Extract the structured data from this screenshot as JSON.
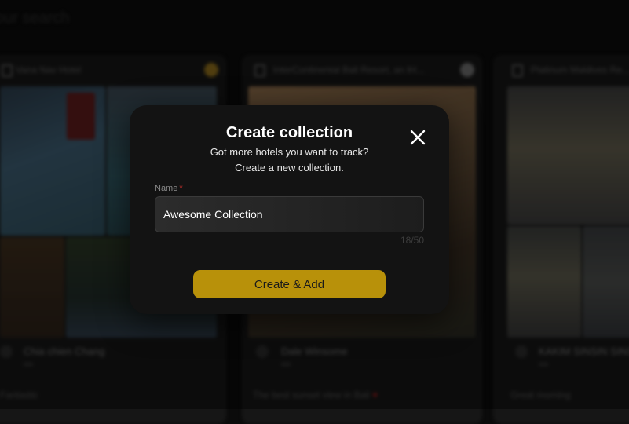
{
  "background": {
    "header_text": "our search",
    "cards": [
      {
        "title": "Vana Nav Hotel",
        "user": "Chia chien Chang",
        "caption": "Fantastic"
      },
      {
        "title": "InterContinental Bali Resort, an IH...",
        "user": "Dale Winsome",
        "caption": "The best sunset view in Bali"
      },
      {
        "title": "Platinum Maldives Re...",
        "user": "KAKIM SINSIN SINS",
        "caption": "Great morning"
      }
    ]
  },
  "modal": {
    "title": "Create collection",
    "description_line1": "Got more hotels you want to track?",
    "description_line2": "Create a new collection.",
    "name_label": "Name",
    "required_mark": "*",
    "name_value": "Awesome Collection",
    "char_count": "18/50",
    "create_button": "Create & Add"
  },
  "colors": {
    "accent": "#b8910a",
    "modal_bg": "#131313",
    "required": "#c9302c"
  },
  "icons": {
    "close": "close-icon",
    "heart": "heart-icon"
  }
}
